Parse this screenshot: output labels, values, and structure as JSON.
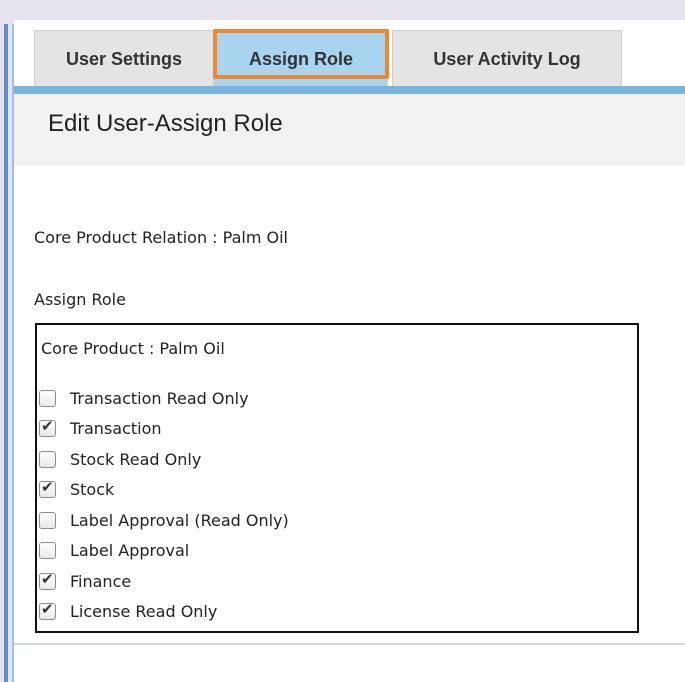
{
  "tabs": [
    {
      "label": "User Settings",
      "active": false
    },
    {
      "label": "Assign Role",
      "active": true
    },
    {
      "label": "User Activity Log",
      "active": false
    }
  ],
  "header": {
    "title": "Edit User-Assign Role"
  },
  "relation": {
    "text": "Core Product Relation : Palm Oil"
  },
  "assign_role": {
    "label": "Assign Role",
    "product": "Core Product : Palm Oil",
    "roles": [
      {
        "label": "Transaction Read Only",
        "checked": false
      },
      {
        "label": "Transaction",
        "checked": true
      },
      {
        "label": "Stock Read Only",
        "checked": false
      },
      {
        "label": "Stock",
        "checked": true
      },
      {
        "label": "Label Approval (Read Only)",
        "checked": false
      },
      {
        "label": "Label Approval",
        "checked": false
      },
      {
        "label": "Finance",
        "checked": true
      },
      {
        "label": "License Read Only",
        "checked": true
      }
    ]
  },
  "colors": {
    "active_tab": "#a9d4ef",
    "highlight": "#f0862d",
    "tab_rule": "#78b4dc"
  }
}
